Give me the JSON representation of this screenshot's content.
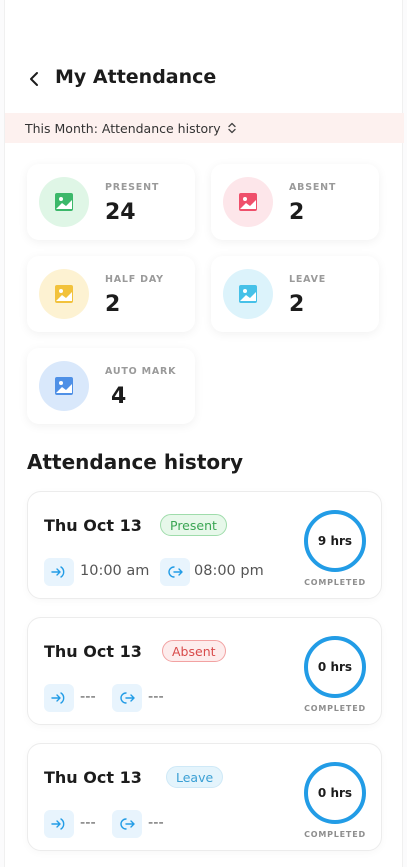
{
  "header": {
    "title": "My Attendance",
    "back_icon": "chevron-left-icon"
  },
  "filter": {
    "label": "This Month: Attendance history",
    "icon": "chevron-up-down-icon"
  },
  "stats": [
    {
      "label": "PRESENT",
      "value": "24",
      "icon": "image-icon",
      "bg": "#dff6e6",
      "color": "#3cb86a"
    },
    {
      "label": "ABSENT",
      "value": "2",
      "icon": "image-icon",
      "bg": "#fde6ea",
      "color": "#ef4f6b"
    },
    {
      "label": "HALF DAY",
      "value": "2",
      "icon": "image-icon",
      "bg": "#fdf2d2",
      "color": "#f2c23c"
    },
    {
      "label": "LEAVE",
      "value": "2",
      "icon": "image-icon",
      "bg": "#dcf3fb",
      "color": "#46c1e8"
    },
    {
      "label": "AUTO MARK",
      "value": "4",
      "icon": "image-icon",
      "bg": "#d9e8fb",
      "color": "#4f90e6"
    }
  ],
  "history": {
    "title": "Attendance history",
    "records": [
      {
        "date": "Thu Oct 13",
        "status": "Present",
        "check_in": "10:00 am",
        "check_out": "08:00 pm",
        "hours": "9 hrs",
        "completed_label": "COMPLETED"
      },
      {
        "date": "Thu Oct 13",
        "status": "Absent",
        "check_in": "---",
        "check_out": "---",
        "hours": "0 hrs",
        "completed_label": "COMPLETED"
      },
      {
        "date": "Thu Oct 13",
        "status": "Leave",
        "check_in": "---",
        "check_out": "---",
        "hours": "0 hrs",
        "completed_label": "COMPLETED"
      }
    ]
  },
  "colors": {
    "accent": "#229ce6",
    "filter_bg": "#fdf1ef"
  }
}
